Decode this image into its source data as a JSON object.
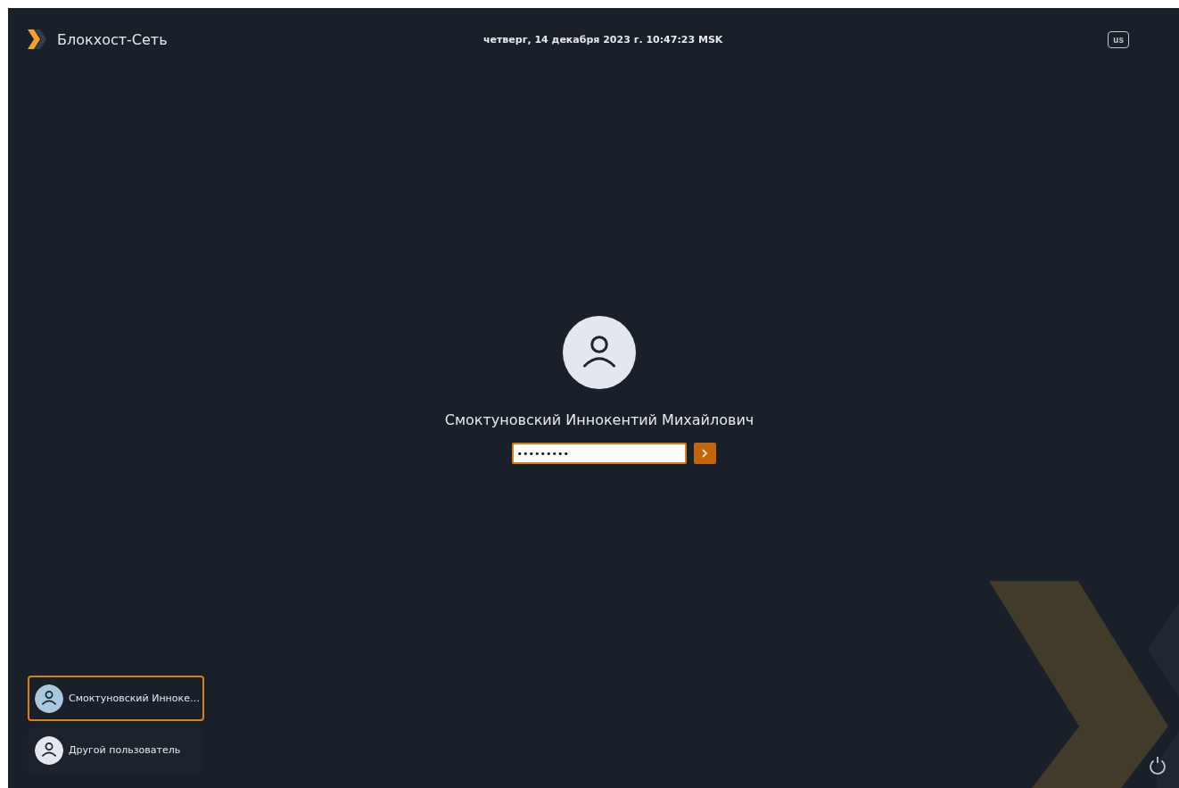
{
  "header": {
    "brand": "Блокхост-Сеть",
    "clock": "четверг, 14 декабря 2023 г. 10:47:23 MSK",
    "keyboard_layout": "us"
  },
  "login": {
    "user_name": "Смоктуновский Иннокентий Михайлович",
    "password": "•••••••••"
  },
  "users": [
    {
      "name": "Смоктуновский Инноке…",
      "selected": true
    },
    {
      "name": "Другой пользователь",
      "selected": false
    }
  ]
}
